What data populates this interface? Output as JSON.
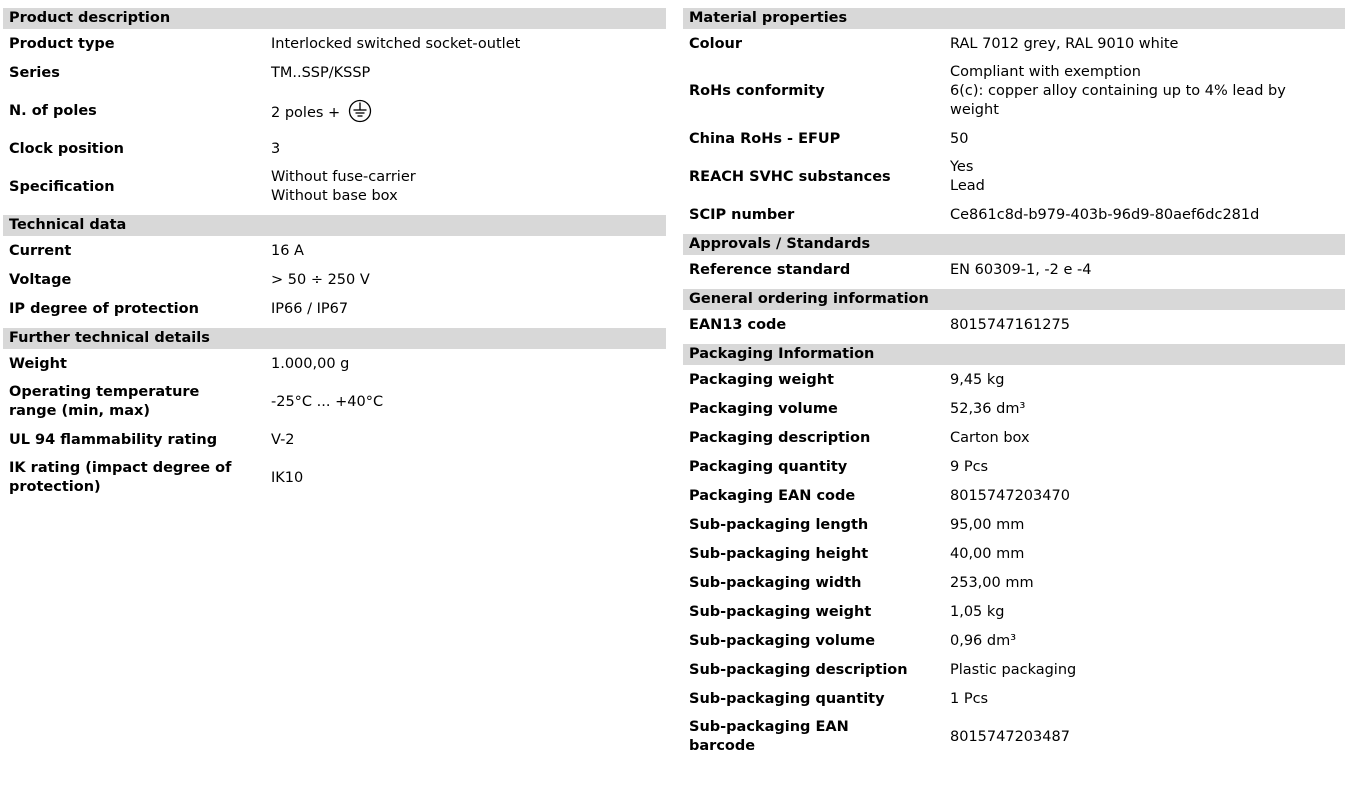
{
  "left": {
    "product_description": {
      "title": "Product description",
      "product_type": {
        "label": "Product type",
        "value": "Interlocked switched socket-outlet"
      },
      "series": {
        "label": "Series",
        "value": "TM..SSP/KSSP"
      },
      "poles": {
        "label": "N. of poles",
        "value": "2 poles +",
        "icon": "earth-ground-icon"
      },
      "clock": {
        "label": "Clock position",
        "value": "3"
      },
      "specification": {
        "label": "Specification",
        "line1": "Without fuse-carrier",
        "line2": "Without base box"
      }
    },
    "technical_data": {
      "title": "Technical data",
      "current": {
        "label": "Current",
        "value": "16 A"
      },
      "voltage": {
        "label": "Voltage",
        "value": "> 50 ÷ 250 V"
      },
      "ip": {
        "label": "IP degree of protection",
        "value": "IP66 / IP67"
      }
    },
    "further": {
      "title": "Further technical details",
      "weight": {
        "label": "Weight",
        "value": "1.000,00 g"
      },
      "temp": {
        "label_line1": "Operating temperature",
        "label_line2": "range (min, max)",
        "value": "-25°C ... +40°C"
      },
      "ul94": {
        "label": "UL 94 flammability rating",
        "value": "V-2"
      },
      "ik": {
        "label_line1": "IK rating (impact degree of",
        "label_line2": "protection)",
        "value": "IK10"
      }
    }
  },
  "right": {
    "material": {
      "title": "Material properties",
      "colour": {
        "label": "Colour",
        "value": "RAL 7012 grey, RAL 9010 white"
      },
      "rohs": {
        "label": "RoHs conformity",
        "line1": "Compliant with exemption",
        "line2": "6(c): copper alloy containing up to 4% lead by",
        "line3": "weight"
      },
      "china": {
        "label": "China RoHs - EFUP",
        "value": "50"
      },
      "reach": {
        "label": "REACH SVHC substances",
        "line1": "Yes",
        "line2": "Lead"
      },
      "scip": {
        "label": "SCIP number",
        "value": "Ce861c8d-b979-403b-96d9-80aef6dc281d"
      }
    },
    "approvals": {
      "title": "Approvals / Standards",
      "standard": {
        "label": "Reference standard",
        "value": "EN 60309-1, -2 e -4"
      }
    },
    "ordering": {
      "title": "General ordering information",
      "ean13": {
        "label": "EAN13 code",
        "value": "8015747161275"
      }
    },
    "packaging": {
      "title": "Packaging Information",
      "rows": [
        {
          "label": "Packaging weight",
          "value": "9,45 kg"
        },
        {
          "label": "Packaging volume",
          "value": "52,36 dm³"
        },
        {
          "label": "Packaging description",
          "value": "Carton box"
        },
        {
          "label": "Packaging quantity",
          "value": "9 Pcs"
        },
        {
          "label": "Packaging EAN code",
          "value": "8015747203470"
        },
        {
          "label": "Sub-packaging length",
          "value": "95,00 mm"
        },
        {
          "label": "Sub-packaging height",
          "value": "40,00 mm"
        },
        {
          "label": "Sub-packaging width",
          "value": "253,00 mm"
        },
        {
          "label": "Sub-packaging weight",
          "value": "1,05 kg"
        },
        {
          "label": "Sub-packaging volume",
          "value": "0,96 dm³"
        },
        {
          "label": "Sub-packaging description",
          "value": "Plastic packaging"
        },
        {
          "label": "Sub-packaging quantity",
          "value": "1 Pcs"
        }
      ],
      "barcode": {
        "label_line1": "Sub-packaging EAN",
        "label_line2": "barcode",
        "value": "8015747203487"
      }
    }
  }
}
